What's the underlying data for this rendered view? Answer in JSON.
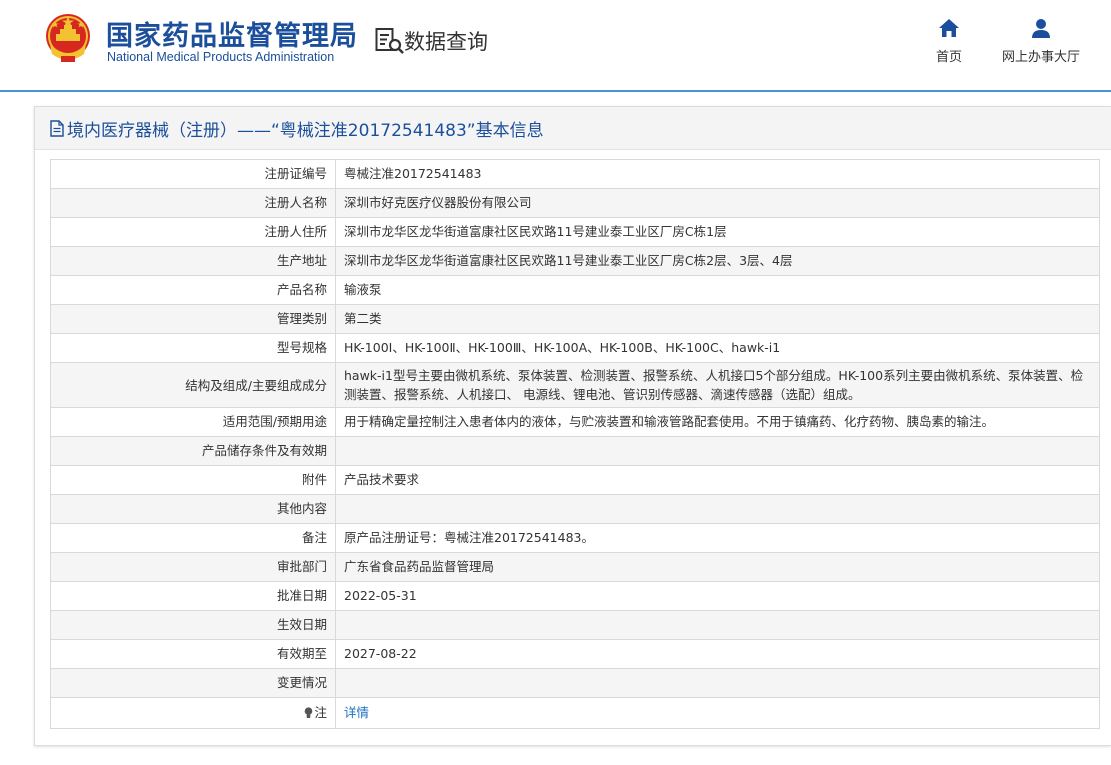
{
  "header": {
    "org_cn": "国家药品监督管理局",
    "org_en": "National Medical Products Administration",
    "emblem_icon": "national-emblem-icon",
    "section_title": "数据查询",
    "section_icon": "data-query-icon",
    "nav": [
      {
        "label": "首页",
        "icon": "home-icon"
      },
      {
        "label": "网上办事大厅",
        "icon": "user-icon"
      }
    ],
    "accent_color": "#1b4f9c",
    "rule_color": "#4a90d9"
  },
  "panel": {
    "title": "境内医疗器械（注册）——“粤械注准20172541483”基本信息",
    "title_icon": "document-icon"
  },
  "rows": [
    {
      "key": "注册证编号",
      "value": "粤械注准20172541483"
    },
    {
      "key": "注册人名称",
      "value": "深圳市好克医疗仪器股份有限公司"
    },
    {
      "key": "注册人住所",
      "value": "深圳市龙华区龙华街道富康社区民欢路11号建业泰工业区厂房C栋1层"
    },
    {
      "key": "生产地址",
      "value": "深圳市龙华区龙华街道富康社区民欢路11号建业泰工业区厂房C栋2层、3层、4层"
    },
    {
      "key": "产品名称",
      "value": "输液泵"
    },
    {
      "key": "管理类别",
      "value": "第二类"
    },
    {
      "key": "型号规格",
      "value": "HK-100Ⅰ、HK-100Ⅱ、HK-100Ⅲ、HK-100A、HK-100B、HK-100C、hawk-i1"
    },
    {
      "key": "结构及组成/主要组成成分",
      "value": "hawk-i1型号主要由微机系统、泵体装置、检测装置、报警系统、人机接口5个部分组成。HK-100系列主要由微机系统、泵体装置、检测装置、报警系统、人机接口、 电源线、锂电池、管识别传感器、滴速传感器（选配）组成。"
    },
    {
      "key": "适用范围/预期用途",
      "value": "用于精确定量控制注入患者体内的液体，与贮液装置和输液管路配套使用。不用于镇痛药、化疗药物、胰岛素的输注。"
    },
    {
      "key": "产品储存条件及有效期",
      "value": ""
    },
    {
      "key": "附件",
      "value": "产品技术要求"
    },
    {
      "key": "其他内容",
      "value": ""
    },
    {
      "key": "备注",
      "value": "原产品注册证号：粤械注准20172541483。"
    },
    {
      "key": "审批部门",
      "value": "广东省食品药品监督管理局"
    },
    {
      "key": "批准日期",
      "value": "2022-05-31"
    },
    {
      "key": "生效日期",
      "value": ""
    },
    {
      "key": "有效期至",
      "value": "2027-08-22"
    },
    {
      "key": "变更情况",
      "value": ""
    },
    {
      "key": "注",
      "value": "详情",
      "key_icon": "bulb-icon"
    }
  ]
}
